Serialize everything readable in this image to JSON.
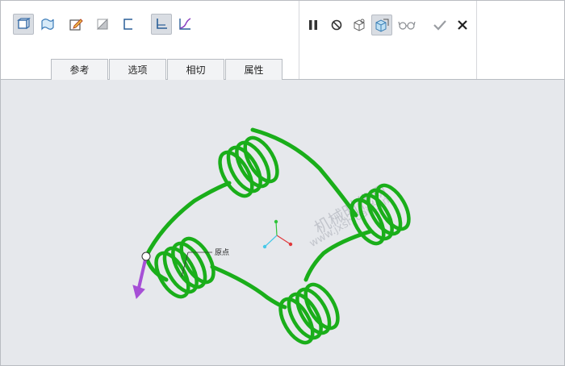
{
  "tabs": [
    {
      "label": "参考"
    },
    {
      "label": "选项"
    },
    {
      "label": "相切"
    },
    {
      "label": "属性"
    }
  ],
  "canvas": {
    "point_label": "原点",
    "watermark_cn": "机械时代网",
    "watermark_url": "www.jxshidai.com"
  },
  "icons": {
    "solid": "solid-icon",
    "surface": "surface-icon",
    "sketch": "sketch-edit-icon",
    "plane": "plane-icon",
    "bracket": "bracket-icon",
    "ruler": "ruler-icon",
    "curve": "curve-icon",
    "pause": "pause-icon",
    "stop": "no-entry-icon",
    "preview": "geometry-preview-icon",
    "verify": "verify-preview-icon",
    "glasses": "glasses-icon",
    "ok": "checkmark-icon",
    "cancel": "close-icon"
  },
  "colors": {
    "helix": "#1aae1a",
    "arrow": "#a64fd6",
    "axis_x": "#e0383b",
    "axis_y": "#2fc43a",
    "axis_z": "#48c8e8"
  }
}
